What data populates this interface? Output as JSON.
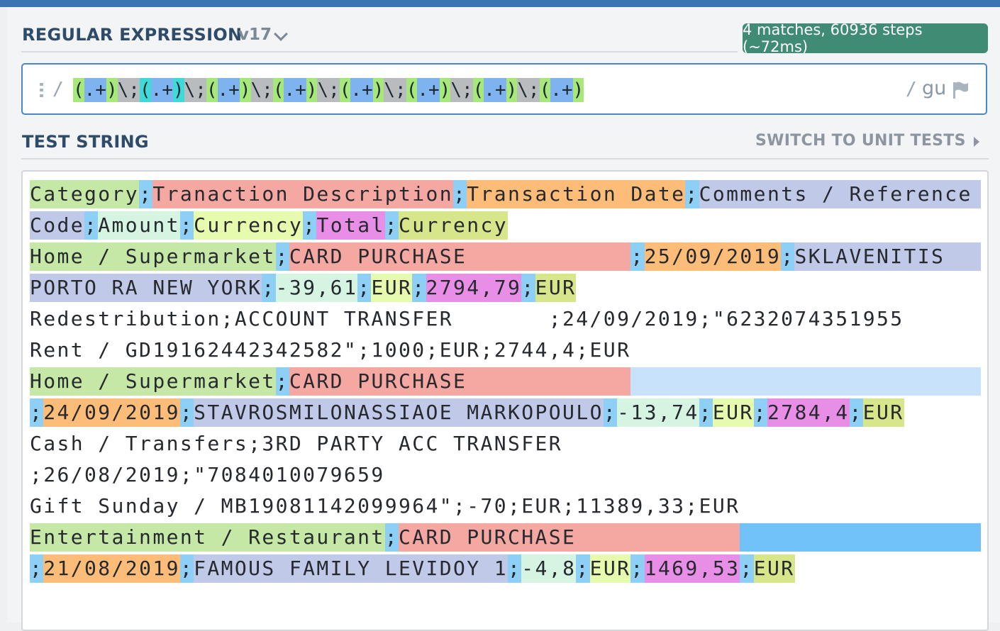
{
  "regex_section": {
    "title": "REGULAR EXPRESSION",
    "version": "v17",
    "match_info": "4 matches, 60936 steps (~72ms)",
    "open_delimiter": "/",
    "close_delimiter": "/",
    "flags": "gu",
    "pattern_tokens": [
      "(",
      ".+",
      ")",
      "\\;",
      "(",
      ".+",
      ")",
      "\\;",
      "(",
      ".+",
      ")",
      "\\;",
      "(",
      ".+",
      ")",
      "\\;",
      "(",
      ".+",
      ")",
      "\\;",
      "(",
      ".+",
      ")",
      "\\;",
      "(",
      ".+",
      ")",
      "\\;",
      "(",
      ".+",
      ")"
    ],
    "icons": {
      "handle": "drag-handle-icon",
      "flag": "flag-icon",
      "chevron": "chevron-down-icon"
    }
  },
  "test_section": {
    "title": "TEST STRING",
    "switch_label": "SWITCH TO UNIT TESTS",
    "lines": [
      [
        [
          "g1",
          "Category"
        ],
        [
          "sep",
          ";"
        ],
        [
          "g2",
          "Tranaction Description"
        ],
        [
          "sep",
          ";"
        ],
        [
          "g3",
          "Transaction Date"
        ],
        [
          "sep",
          ";"
        ],
        [
          "g4",
          "Comments / Reference"
        ]
      ],
      [
        [
          "g4",
          "Code"
        ],
        [
          "sep",
          ";"
        ],
        [
          "g5",
          "Amount"
        ],
        [
          "sep",
          ";"
        ],
        [
          "g6",
          "Currency"
        ],
        [
          "sep",
          ";"
        ],
        [
          "g7",
          "Total"
        ],
        [
          "sep",
          ";"
        ],
        [
          "g8",
          "Currency"
        ]
      ],
      [
        [
          "g1",
          "Home / Supermarket"
        ],
        [
          "sep",
          ";"
        ],
        [
          "g2",
          "CARD PURCHASE            "
        ],
        [
          "sep",
          ";"
        ],
        [
          "g3",
          "25/09/2019"
        ],
        [
          "sep",
          ";"
        ],
        [
          "g4",
          "SKLAVENITIS"
        ]
      ],
      [
        [
          "g4",
          "PORTO RA NEW YORK"
        ],
        [
          "sep",
          ";"
        ],
        [
          "g5",
          "-39,61"
        ],
        [
          "sep",
          ";"
        ],
        [
          "g6",
          "EUR"
        ],
        [
          "sep",
          ";"
        ],
        [
          "g7",
          "2794,79"
        ],
        [
          "sep",
          ";"
        ],
        [
          "g8",
          "EUR"
        ]
      ],
      [
        [
          "",
          "Redestribution;ACCOUNT TRANSFER       ;24/09/2019;\"6232074351955"
        ]
      ],
      [
        [
          "",
          "Rent / GD19162442342582\";1000;EUR;2744,4;EUR"
        ]
      ],
      [
        [
          "g1",
          "Home / Supermarket"
        ],
        [
          "sep",
          ";"
        ],
        [
          "g2",
          "CARD PURCHASE            "
        ]
      ],
      [
        [
          "sep",
          ";"
        ],
        [
          "g3",
          "24/09/2019"
        ],
        [
          "sep",
          ";"
        ],
        [
          "g4",
          "STAVROSMILONASSIAOE MARKOPOULO"
        ],
        [
          "sep",
          ";"
        ],
        [
          "g5",
          "-13,74"
        ],
        [
          "sep",
          ";"
        ],
        [
          "g6",
          "EUR"
        ],
        [
          "sep",
          ";"
        ],
        [
          "g7",
          "2784,4"
        ],
        [
          "sep",
          ";"
        ],
        [
          "g8",
          "EUR"
        ]
      ],
      [
        [
          "",
          "Cash / Transfers;3RD PARTY ACC TRANSFER"
        ]
      ],
      [
        [
          "",
          ";26/08/2019;\"7084010079659"
        ]
      ],
      [
        [
          "",
          "Gift Sunday / MB19081142099964\";-70;EUR;11389,33;EUR"
        ]
      ],
      [
        [
          "g1",
          "Entertainment / Restaurant"
        ],
        [
          "sep",
          ";"
        ],
        [
          "g2",
          "CARD PURCHASE            "
        ]
      ],
      [
        [
          "sep",
          ";"
        ],
        [
          "g3",
          "21/08/2019"
        ],
        [
          "sep",
          ";"
        ],
        [
          "g4",
          "FAMOUS FAMILY LEVIDOY 1"
        ],
        [
          "sep",
          ";"
        ],
        [
          "g5",
          "-4,8"
        ],
        [
          "sep",
          ";"
        ],
        [
          "g6",
          "EUR"
        ],
        [
          "sep",
          ";"
        ],
        [
          "g7",
          "1469,53"
        ],
        [
          "sep",
          ";"
        ],
        [
          "g8",
          "EUR"
        ]
      ]
    ],
    "line_fill": [
      "g4",
      "",
      "g4",
      "",
      "",
      "",
      "fill",
      "",
      "",
      "",
      "",
      "fill2",
      ""
    ]
  },
  "colors": {
    "accent": "#3b74b3",
    "badge": "#3f8b74",
    "regex_border": "#4a87c9",
    "group_colors": [
      "#c6e8a6",
      "#f5a8a2",
      "#fdbd78",
      "#c0cae8",
      "#d5f5e2",
      "#e7fbae",
      "#e88ee6",
      "#d7e68b"
    ],
    "separator": "#8ed0f5"
  }
}
